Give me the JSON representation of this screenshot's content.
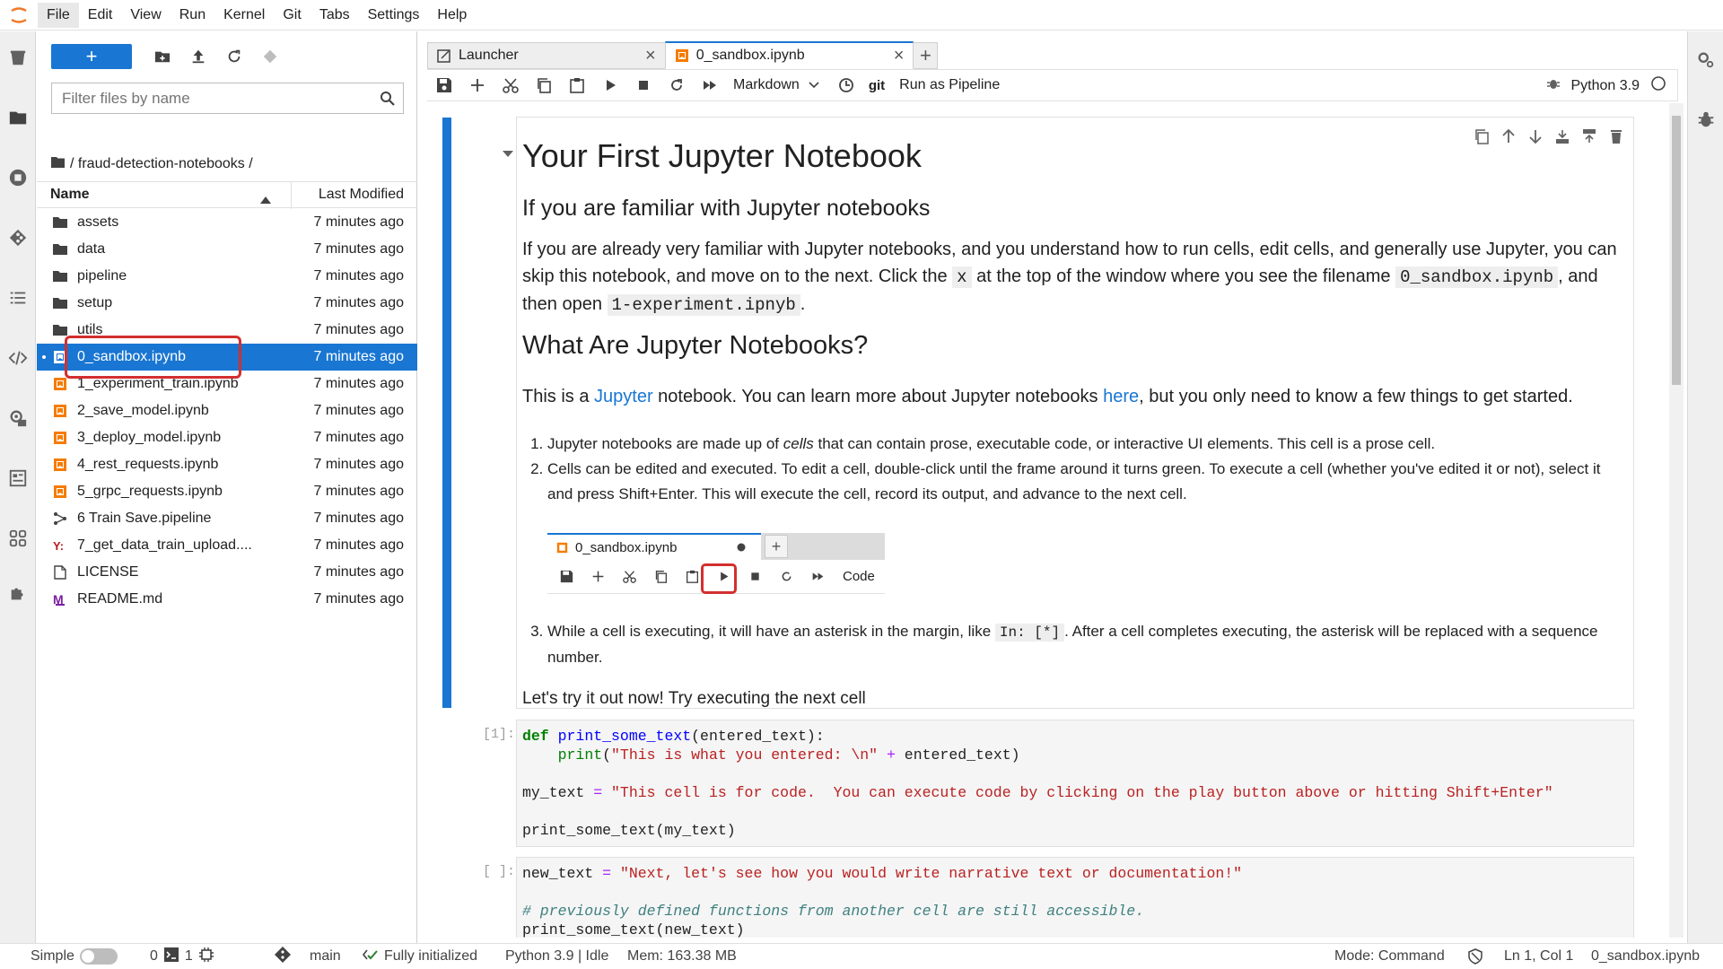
{
  "menubar": {
    "items": [
      "File",
      "Edit",
      "View",
      "Run",
      "Kernel",
      "Git",
      "Tabs",
      "Settings",
      "Help"
    ],
    "active_index": 0
  },
  "left_activity_icons": [
    "trash-icon",
    "folder-icon",
    "running-icon",
    "git-icon",
    "toc-icon",
    "code-snippets-icon",
    "pipeline-runtimes-icon",
    "property-inspector-icon",
    "extensions-grid-icon",
    "puzzle-icon"
  ],
  "right_activity_icons": [
    "property-inspector-icon",
    "debugger-icon"
  ],
  "file_browser": {
    "new_button_label": "+",
    "filter_placeholder": "Filter files by name",
    "breadcrumb": "/ fraud-detection-notebooks /",
    "column_name": "Name",
    "column_modified": "Last Modified",
    "files": [
      {
        "name": "assets",
        "type": "folder",
        "modified": "7 minutes ago"
      },
      {
        "name": "data",
        "type": "folder",
        "modified": "7 minutes ago"
      },
      {
        "name": "pipeline",
        "type": "folder",
        "modified": "7 minutes ago"
      },
      {
        "name": "setup",
        "type": "folder",
        "modified": "7 minutes ago"
      },
      {
        "name": "utils",
        "type": "folder",
        "modified": "7 minutes ago"
      },
      {
        "name": "0_sandbox.ipynb",
        "type": "notebook",
        "modified": "7 minutes ago",
        "selected": true
      },
      {
        "name": "1_experiment_train.ipynb",
        "type": "notebook",
        "modified": "7 minutes ago"
      },
      {
        "name": "2_save_model.ipynb",
        "type": "notebook",
        "modified": "7 minutes ago"
      },
      {
        "name": "3_deploy_model.ipynb",
        "type": "notebook",
        "modified": "7 minutes ago"
      },
      {
        "name": "4_rest_requests.ipynb",
        "type": "notebook",
        "modified": "7 minutes ago"
      },
      {
        "name": "5_grpc_requests.ipynb",
        "type": "notebook",
        "modified": "7 minutes ago"
      },
      {
        "name": "6 Train Save.pipeline",
        "type": "pipeline",
        "modified": "7 minutes ago"
      },
      {
        "name": "7_get_data_train_upload....",
        "type": "yaml",
        "modified": "7 minutes ago"
      },
      {
        "name": "LICENSE",
        "type": "file",
        "modified": "7 minutes ago"
      },
      {
        "name": "README.md",
        "type": "markdown",
        "modified": "7 minutes ago"
      }
    ]
  },
  "tabs": [
    {
      "label": "Launcher",
      "active": false
    },
    {
      "label": "0_sandbox.ipynb",
      "active": true
    }
  ],
  "notebook_toolbar": {
    "cell_type": "Markdown",
    "git_label": "git",
    "pipeline_label": "Run as Pipeline",
    "kernel_name": "Python 3.9"
  },
  "markdown_cell": {
    "h1": "Your First Jupyter Notebook",
    "h2_familiar": "If you are familiar with Jupyter notebooks",
    "p1_a": "If you are already very familiar with Jupyter notebooks, and you understand how to run cells, edit cells, and generally use Jupyter, you can skip this notebook, and move on to the next. Click the ",
    "p1_code_x": "x",
    "p1_b": " at the top of the window where you see the filename ",
    "p1_code_file": "0_sandbox.ipynb",
    "p1_c": ", and then open ",
    "p1_code_next": "1-experiment.ipnyb",
    "p1_d": ".",
    "h2_what": "What Are Jupyter Notebooks?",
    "p2_a": "This is a ",
    "p2_link1": "Jupyter",
    "p2_b": " notebook. You can learn more about Jupyter notebooks ",
    "p2_link2": "here",
    "p2_c": ", but you only need to know a few things to get started.",
    "li1_a": "Jupyter notebooks are made up of ",
    "li1_em": "cells",
    "li1_b": " that can contain prose, executable code, or interactive UI elements. This cell is a prose cell.",
    "li2": "Cells can be edited and executed. To edit a cell, double-click until the frame around it turns green. To execute a cell (whether you've edited it or not), select it and press Shift+Enter. This will execute the cell, record its output, and advance to the next cell.",
    "mini_tab_label": "0_sandbox.ipynb",
    "mini_cell_type": "Code",
    "li3_a": "While a cell is executing, it will have an asterisk in the margin, like ",
    "li3_code": "In: [*]",
    "li3_b": ". After a cell completes executing, the asterisk will be replaced with a sequence number.",
    "p3": "Let's try it out now! Try executing the next cell"
  },
  "code_cell_1": {
    "prompt": "[1]:",
    "line1_kw": "def",
    "line1_fn": "print_some_text",
    "line1_rest": "(entered_text):",
    "line2_indent": "    ",
    "line2_bi": "print",
    "line2_str": "\"This is what you entered: \\n\"",
    "line2_op": "+",
    "line2_rest": " entered_text)",
    "line4_var": "my_text ",
    "line4_op": "=",
    "line4_str": "\"This cell is for code.  You can execute code by clicking on the play button above or hitting Shift+Enter\"",
    "line6": "print_some_text(my_text)"
  },
  "code_cell_2": {
    "prompt": "[ ]:",
    "line1_var": "new_text ",
    "line1_op": "=",
    "line1_str": "\"Next, let's see how you would write narrative text or documentation!\"",
    "line3_comment": "# previously defined functions from another cell are still accessible.",
    "line4": "print_some_text(new_text)"
  },
  "status_bar": {
    "mode_toggle_label": "Simple",
    "terminals_count": "0",
    "kernels_count": "1",
    "git_branch": "main",
    "init_status": "Fully initialized",
    "kernel_status": "Python 3.9 | Idle",
    "memory": "Mem: 163.38 MB",
    "mode": "Mode: Command",
    "cursor_position": "Ln 1, Col 1",
    "active_file": "0_sandbox.ipynb"
  },
  "colors": {
    "accent": "#1976d2",
    "highlight_red": "#d32f2f",
    "notebook_orange": "#f57c00"
  }
}
